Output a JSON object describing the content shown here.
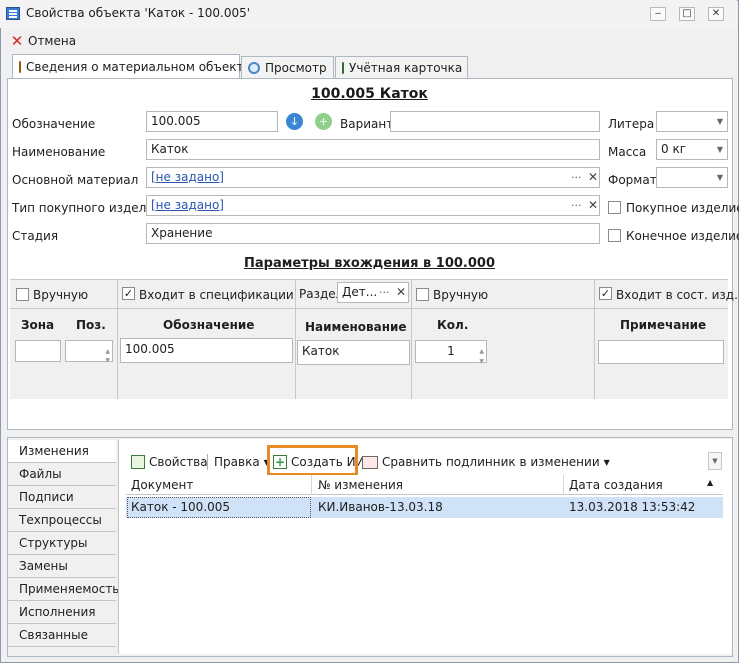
{
  "window": {
    "title": "Свойства объекта 'Каток - 100.005'",
    "minimize": "‒",
    "maximize": "□",
    "close": "✕"
  },
  "toolbar": {
    "cancel_label": "Отмена"
  },
  "tabs": [
    {
      "label": "Сведения о материальном объекте",
      "icon": "object-info-icon"
    },
    {
      "label": "Просмотр",
      "icon": "search-icon"
    },
    {
      "label": "Учётная карточка",
      "icon": "card-icon"
    }
  ],
  "header": {
    "title": "100.005 Каток"
  },
  "form": {
    "designation_label": "Обозначение",
    "designation_value": "100.005",
    "variant_label": "Вариант",
    "variant_value": "",
    "litera_label": "Литера",
    "litera_value": "",
    "name_label": "Наименование",
    "name_value": "Каток",
    "mass_label": "Масса",
    "mass_value": "0 кг",
    "material_label": "Основной материал",
    "material_value": "[не задано]",
    "format_label": "Формат",
    "format_value": "",
    "purchased_type_label": "Тип покупного изделия",
    "purchased_type_value": "[не задано]",
    "purchased_item_label": "Покупное изделие",
    "purchased_item_checked": false,
    "stage_label": "Стадия",
    "stage_value": "Хранение",
    "final_item_label": "Конечное изделие",
    "final_item_checked": false,
    "ellipsis": "···",
    "clear": "✕"
  },
  "params": {
    "title": "Параметры вхождения в 100.000",
    "manual_label": "Вручную",
    "manual_checked": false,
    "in_spec_label": "Входит в спецификации",
    "in_spec_checked": true,
    "section_label": "Раздел",
    "section_value": "Дет...",
    "manual2_label": "Вручную",
    "manual2_checked": false,
    "in_comp_label": "Входит в сост. изд.",
    "in_comp_checked": true,
    "col_zone": "Зона",
    "col_pos": "Поз.",
    "col_designation": "Обозначение",
    "col_name": "Наименование",
    "col_qty": "Кол.",
    "col_note": "Примечание",
    "designation_value": "100.005",
    "name_value": "Каток",
    "qty_value": "1"
  },
  "bottom": {
    "vtabs": [
      "Изменения",
      "Файлы",
      "Подписи",
      "Техпроцессы",
      "Структуры",
      "Замены",
      "Применяемость",
      "Исполнения",
      "Связанные"
    ],
    "active_vtab": 0,
    "toolbar": {
      "properties": "Свойства",
      "edit": "Правка",
      "create": "Создать ИИ",
      "compare": "Сравнить подлинник в изменении"
    },
    "table": {
      "columns": [
        "Документ",
        "№ изменения",
        "Дата создания"
      ],
      "rows": [
        [
          "Каток - 100.005",
          "КИ.Иванов-13.03.18",
          "13.03.2018 13:53:42"
        ]
      ]
    }
  },
  "colors": {
    "highlight": "#e98b23",
    "selected_row": "#cfe2f8",
    "link": "#2a55b0"
  }
}
